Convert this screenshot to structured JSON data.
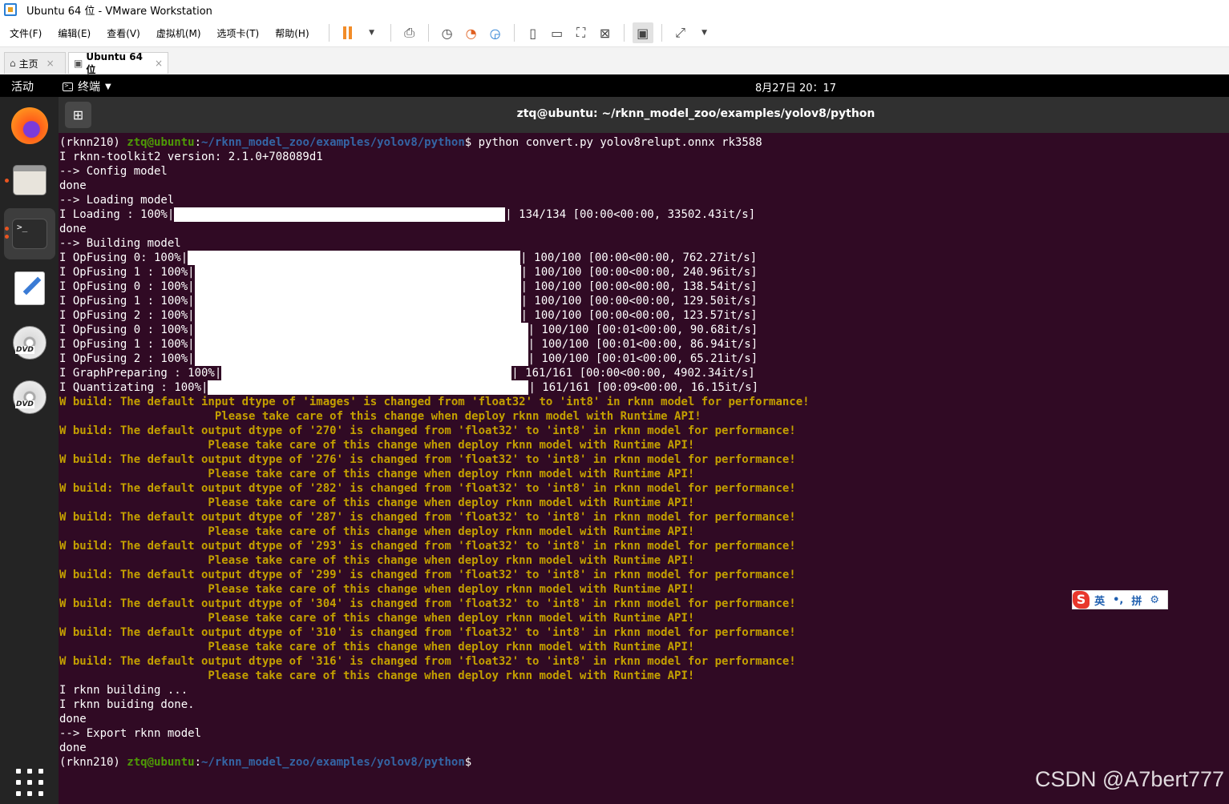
{
  "window": {
    "title": "Ubuntu 64 位 - VMware Workstation",
    "menu": [
      "文件(F)",
      "编辑(E)",
      "查看(V)",
      "虚拟机(M)",
      "选项卡(T)",
      "帮助(H)"
    ],
    "tabs": [
      {
        "label": "主页",
        "close": "×"
      },
      {
        "label": "Ubuntu 64 位",
        "close": "×"
      }
    ]
  },
  "ubuntu": {
    "activities": "活动",
    "app_menu": "终端",
    "clock": "8月27日  20：17"
  },
  "terminal": {
    "title": "ztq@ubuntu: ~/rknn_model_zoo/examples/yolov8/python",
    "prompt_env": "(rknn210) ",
    "prompt_user": "ztq@ubuntu",
    "prompt_colon": ":",
    "prompt_path": "~/rknn_model_zoo/examples/yolov8/python",
    "prompt_dollar": "$",
    "command": " python convert.py yolov8relupt.onnx rk3588",
    "lines": [
      {
        "text": "I rknn-toolkit2 version: 2.1.0+708089d1"
      },
      {
        "text": "--> Config model"
      },
      {
        "text": "done"
      },
      {
        "text": "--> Loading model"
      },
      {
        "text": "I Loading : 100%|",
        "bar": 0.283,
        "tail": "| 134/134 [00:00<00:00, 33502.43it/s]"
      },
      {
        "text": "done"
      },
      {
        "text": "--> Building model"
      },
      {
        "text": "I OpFusing 0: 100%|",
        "bar": 0.284,
        "tail": "| 100/100 [00:00<00:00, 762.27it/s]"
      },
      {
        "text": "I OpFusing 1 : 100%|",
        "bar": 0.279,
        "tail": "| 100/100 [00:00<00:00, 240.96it/s]"
      },
      {
        "text": "I OpFusing 0 : 100%|",
        "bar": 0.279,
        "tail": "| 100/100 [00:00<00:00, 138.54it/s]"
      },
      {
        "text": "I OpFusing 1 : 100%|",
        "bar": 0.279,
        "tail": "| 100/100 [00:00<00:00, 129.50it/s]"
      },
      {
        "text": "I OpFusing 2 : 100%|",
        "bar": 0.279,
        "tail": "| 100/100 [00:00<00:00, 123.57it/s]"
      },
      {
        "text": "I OpFusing 0 : 100%|",
        "bar": 0.285,
        "tail": "| 100/100 [00:01<00:00, 90.68it/s]"
      },
      {
        "text": "I OpFusing 1 : 100%|",
        "bar": 0.285,
        "tail": "| 100/100 [00:01<00:00, 86.94it/s]"
      },
      {
        "text": "I OpFusing 2 : 100%|",
        "bar": 0.285,
        "tail": "| 100/100 [00:01<00:00, 65.21it/s]"
      },
      {
        "text": "I GraphPreparing : 100%|",
        "bar": 0.248,
        "tail": "| 161/161 [00:00<00:00, 4902.34it/s]"
      },
      {
        "text": "I Quantizating : 100%|",
        "bar": 0.274,
        "tail": "| 161/161 [00:09<00:00, 16.15it/s]"
      },
      {
        "text": "W build: The default input dtype of 'images' is changed from 'float32' to 'int8' in rknn model for performance!",
        "warn": true
      },
      {
        "text": "                       Please take care of this change when deploy rknn model with Runtime API!",
        "warn": true
      },
      {
        "text": "W build: The default output dtype of '270' is changed from 'float32' to 'int8' in rknn model for performance!",
        "warn": true
      },
      {
        "text": "                      Please take care of this change when deploy rknn model with Runtime API!",
        "warn": true
      },
      {
        "text": "W build: The default output dtype of '276' is changed from 'float32' to 'int8' in rknn model for performance!",
        "warn": true
      },
      {
        "text": "                      Please take care of this change when deploy rknn model with Runtime API!",
        "warn": true
      },
      {
        "text": "W build: The default output dtype of '282' is changed from 'float32' to 'int8' in rknn model for performance!",
        "warn": true
      },
      {
        "text": "                      Please take care of this change when deploy rknn model with Runtime API!",
        "warn": true
      },
      {
        "text": "W build: The default output dtype of '287' is changed from 'float32' to 'int8' in rknn model for performance!",
        "warn": true
      },
      {
        "text": "                      Please take care of this change when deploy rknn model with Runtime API!",
        "warn": true
      },
      {
        "text": "W build: The default output dtype of '293' is changed from 'float32' to 'int8' in rknn model for performance!",
        "warn": true
      },
      {
        "text": "                      Please take care of this change when deploy rknn model with Runtime API!",
        "warn": true
      },
      {
        "text": "W build: The default output dtype of '299' is changed from 'float32' to 'int8' in rknn model for performance!",
        "warn": true
      },
      {
        "text": "                      Please take care of this change when deploy rknn model with Runtime API!",
        "warn": true
      },
      {
        "text": "W build: The default output dtype of '304' is changed from 'float32' to 'int8' in rknn model for performance!",
        "warn": true
      },
      {
        "text": "                      Please take care of this change when deploy rknn model with Runtime API!",
        "warn": true
      },
      {
        "text": "W build: The default output dtype of '310' is changed from 'float32' to 'int8' in rknn model for performance!",
        "warn": true
      },
      {
        "text": "                      Please take care of this change when deploy rknn model with Runtime API!",
        "warn": true
      },
      {
        "text": "W build: The default output dtype of '316' is changed from 'float32' to 'int8' in rknn model for performance!",
        "warn": true
      },
      {
        "text": "                      Please take care of this change when deploy rknn model with Runtime API!",
        "warn": true
      },
      {
        "text": "I rknn building ..."
      },
      {
        "text": "I rknn buiding done."
      },
      {
        "text": "done"
      },
      {
        "text": "--> Export rknn model"
      },
      {
        "text": "done"
      }
    ],
    "colors": {
      "background": "#300a24",
      "warning": "#c4a000",
      "user": "#4e9a06",
      "path": "#3465a4"
    }
  },
  "ime": {
    "logo": "S",
    "lang": "英",
    "punct": "•,",
    "mode": "拼",
    "settings_icon": "gear-icon"
  },
  "watermark": "CSDN @A7bert777"
}
